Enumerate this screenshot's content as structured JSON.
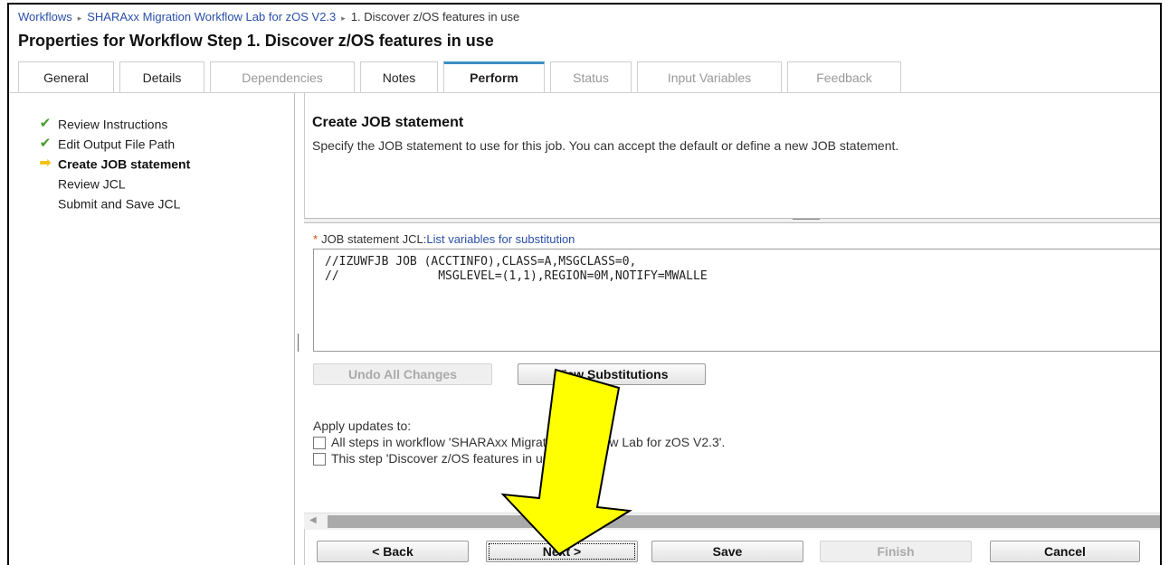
{
  "breadcrumb": {
    "items": [
      "Workflows",
      "SHARAxx Migration Workflow Lab for zOS V2.3",
      "1. Discover z/OS features in use"
    ],
    "separator": "▸"
  },
  "page_title": "Properties for Workflow Step 1. Discover z/OS features in use",
  "tabs": [
    {
      "label": "General",
      "state": "normal"
    },
    {
      "label": "Details",
      "state": "normal"
    },
    {
      "label": "Dependencies",
      "state": "disabled"
    },
    {
      "label": "Notes",
      "state": "normal"
    },
    {
      "label": "Perform",
      "state": "active"
    },
    {
      "label": "Status",
      "state": "disabled"
    },
    {
      "label": "Input Variables",
      "state": "disabled"
    },
    {
      "label": "Feedback",
      "state": "disabled"
    }
  ],
  "steps": [
    {
      "label": "Review Instructions",
      "icon": "check-icon",
      "status": "done"
    },
    {
      "label": "Edit Output File Path",
      "icon": "check-icon",
      "status": "done"
    },
    {
      "label": "Create JOB statement",
      "icon": "arrow-right-icon",
      "status": "current"
    },
    {
      "label": "Review JCL",
      "icon": "",
      "status": "pending"
    },
    {
      "label": "Submit and Save JCL",
      "icon": "",
      "status": "pending"
    }
  ],
  "main": {
    "title": "Create JOB statement",
    "description": "Specify the JOB statement to use for this job. You can accept the default or define a new JOB statement.",
    "jcl_label": "JOB statement JCL:",
    "jcl_required_marker": "*",
    "jcl_link": "List variables for substitution",
    "jcl_text": "//IZUWFJB JOB (ACCTINFO),CLASS=A,MSGCLASS=0,\n//              MSGLEVEL=(1,1),REGION=0M,NOTIFY=MWALLE",
    "undo_label": "Undo All Changes",
    "view_subs_label": "View Substitutions",
    "apply_label": "Apply updates to:",
    "apply_options": [
      {
        "label": "All steps in workflow 'SHARAxx Migration Workflow Lab for zOS V2.3'.",
        "checked": false
      },
      {
        "label": "This step 'Discover z/OS features in use' only.",
        "checked": false
      }
    ]
  },
  "footer": {
    "back_label": "< Back",
    "next_label": "Next >",
    "save_label": "Save",
    "finish_label": "Finish",
    "cancel_label": "Cancel"
  },
  "colors": {
    "accent_tab": "#3b8ec4",
    "link": "#2a4fa8",
    "check": "#4a9a2a",
    "highlight_arrow": "#ffff00"
  }
}
